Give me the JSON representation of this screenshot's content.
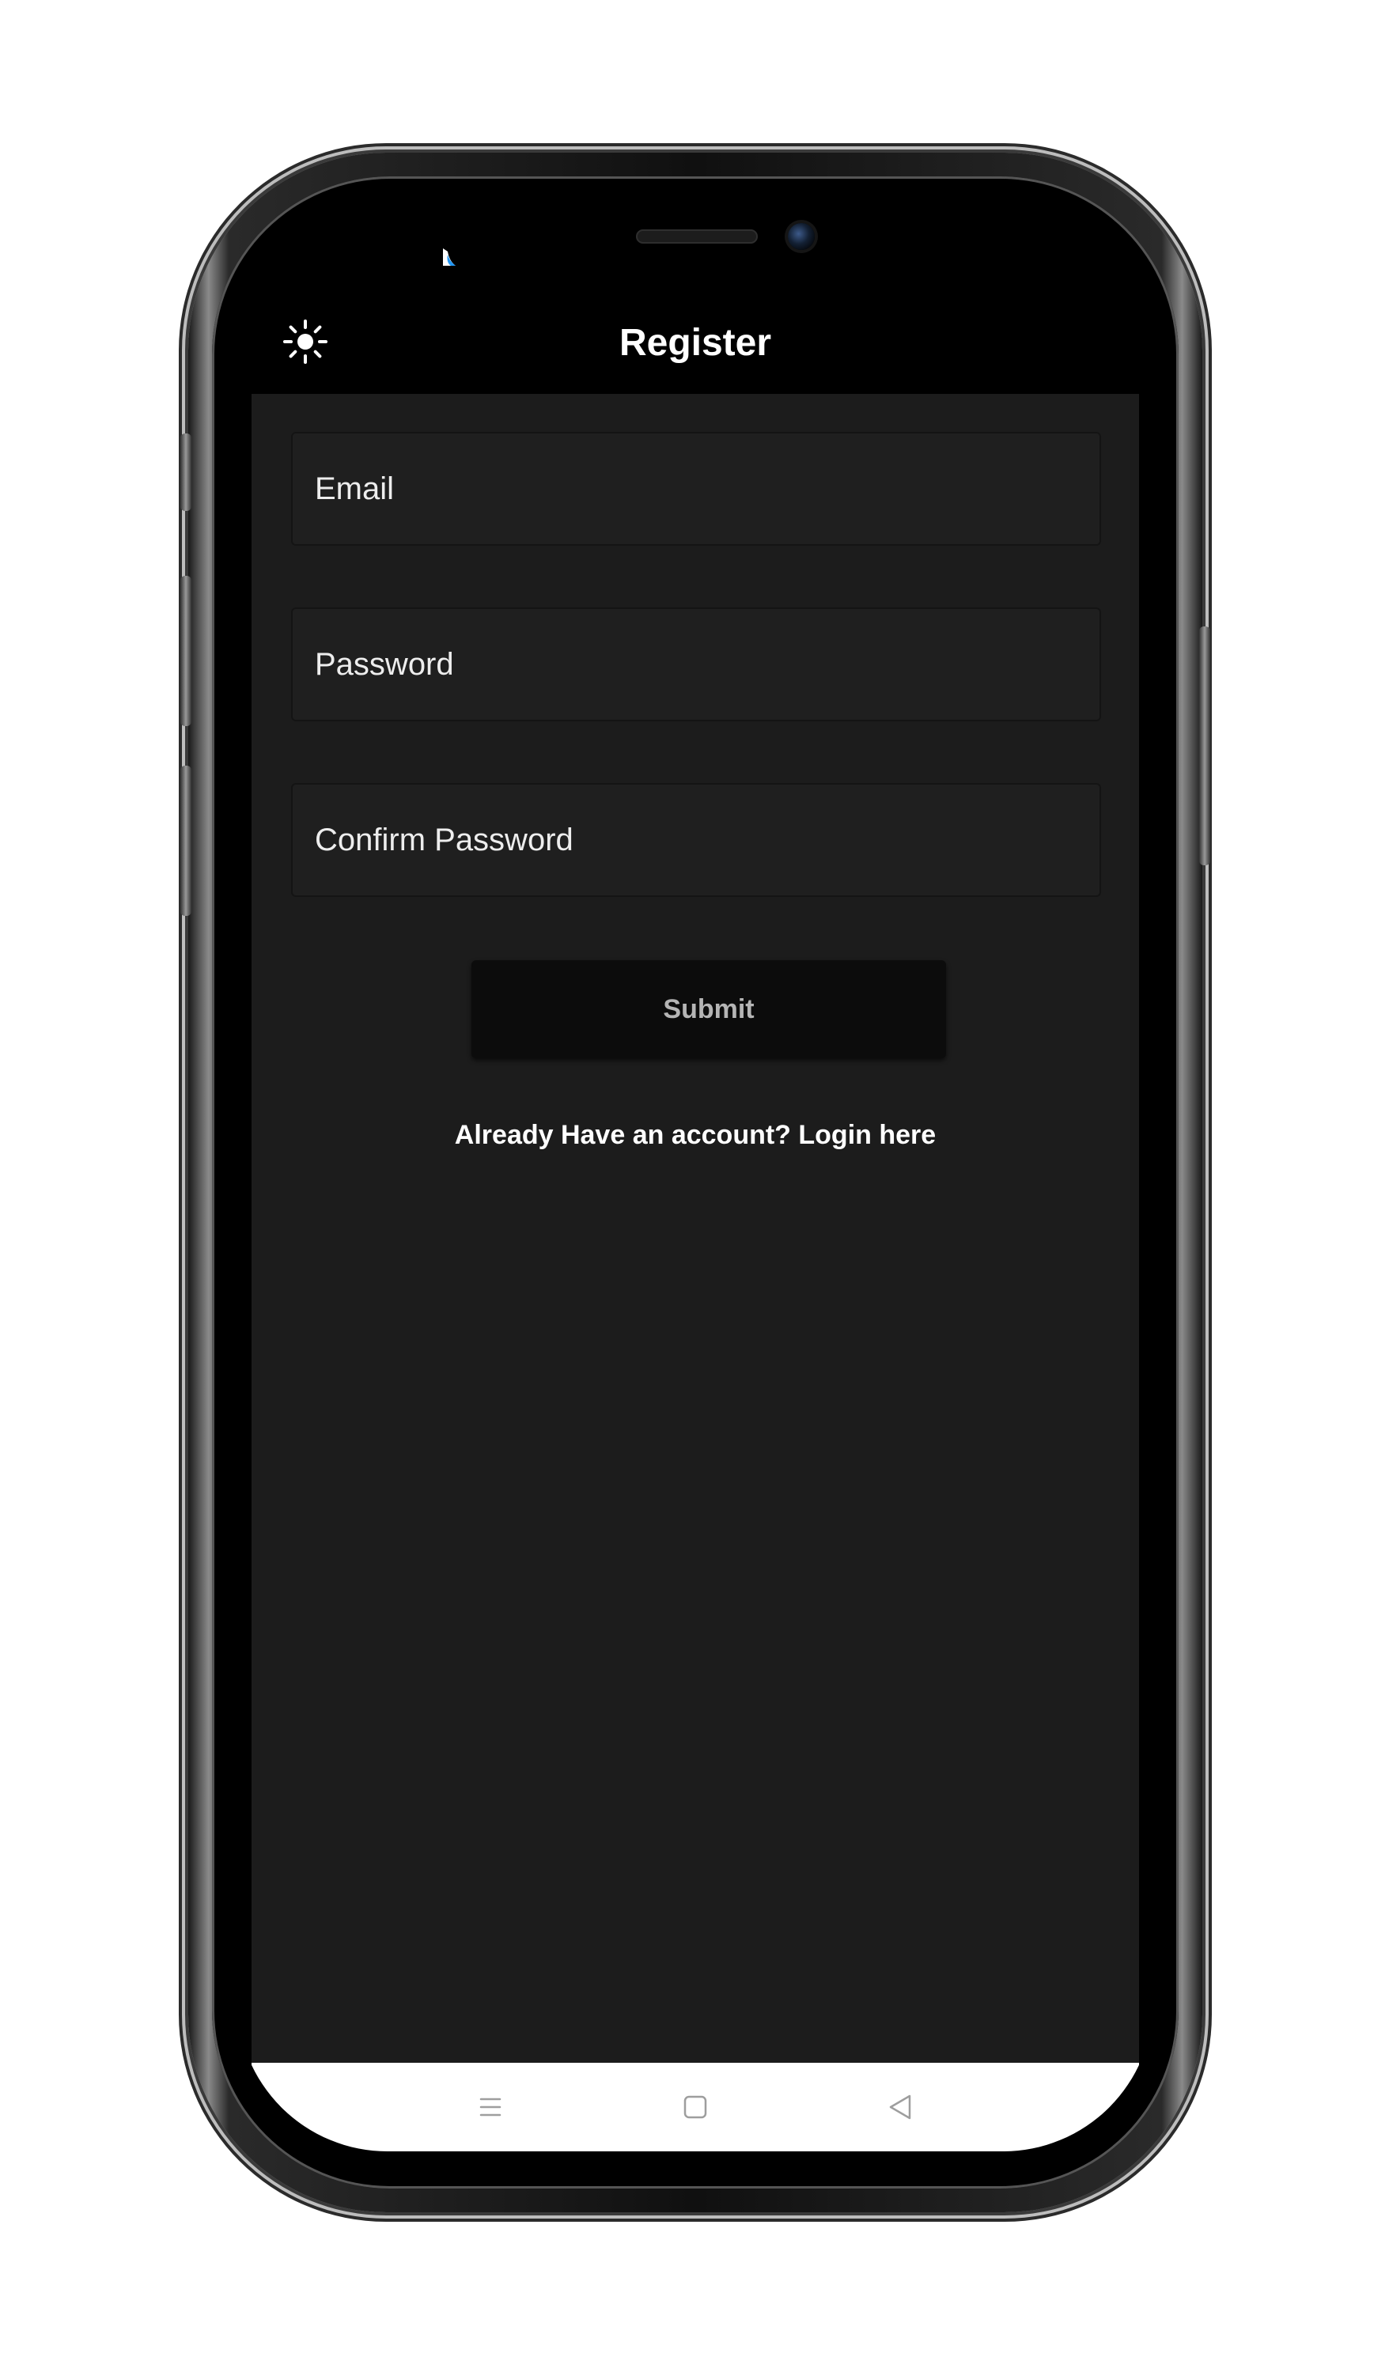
{
  "appbar": {
    "title": "Register",
    "theme_toggle_icon": "sun-icon"
  },
  "form": {
    "email_placeholder": "Email",
    "password_placeholder": "Password",
    "confirm_password_placeholder": "Confirm Password",
    "submit_label": "Submit",
    "login_link_text": "Already Have an account? Login here"
  },
  "navbar": {
    "icons": [
      "menu-icon",
      "home-icon",
      "back-icon"
    ]
  },
  "colors": {
    "background": "#1c1c1c",
    "appbar": "#000000",
    "text": "#ffffff",
    "button": "#0c0c0c",
    "button_text": "#b5b5b5",
    "status_accent": "#2196f3"
  }
}
